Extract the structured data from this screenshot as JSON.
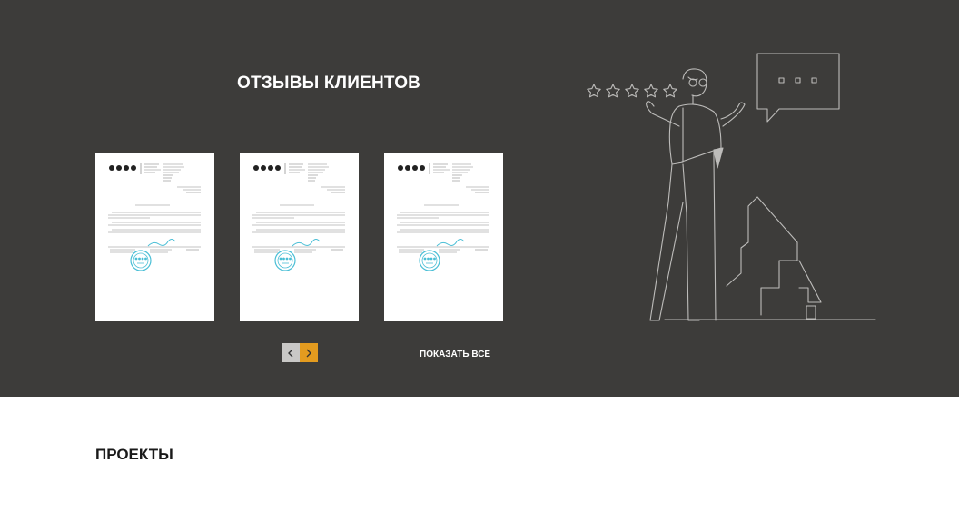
{
  "reviews": {
    "title": "ОТЗЫВЫ КЛИЕНТОВ",
    "show_all_label": "ПОКАЗАТЬ ВСЕ",
    "letters_count": 3
  },
  "slider": {
    "prev_icon": "chevron-left-icon",
    "next_icon": "chevron-right-icon"
  },
  "illustration": {
    "stars": 5,
    "icons": [
      "star-icon",
      "chat-bubble-icon",
      "person-shrugging",
      "stairs"
    ]
  },
  "projects": {
    "title": "ПРОЕКТЫ"
  },
  "colors": {
    "dark_bg": "#3d3c3a",
    "accent": "#e39b1f",
    "nav_inactive": "#c9c8c6",
    "stamp": "#4bbfd6",
    "line_art": "#bdbcba"
  }
}
